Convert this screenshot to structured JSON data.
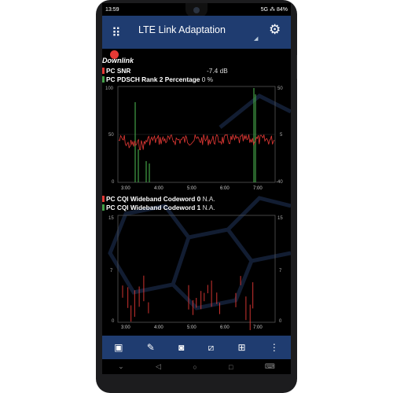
{
  "status": {
    "time": "13:59",
    "right": "5G ⁂ 84%"
  },
  "app": {
    "title": "LTE Link Adaptation"
  },
  "sections": {
    "downlink": "Downlink"
  },
  "metrics": {
    "pc_snr": {
      "label": "PC SNR",
      "value": "-7.4 dB",
      "color": "#e53935"
    },
    "pc_pdsch": {
      "label": "PC PDSCH Rank 2 Percentage",
      "value": "0 %",
      "color": "#43a047"
    },
    "cqi0": {
      "label": "PC CQI Wideband Codeword 0",
      "value": "N.A.",
      "color": "#e53935"
    },
    "cqi1": {
      "label": "PC CQI Wideband Codeword 1",
      "value": "N.A.",
      "color": "#43a047"
    }
  },
  "chart_data": [
    {
      "type": "line",
      "x_ticks": [
        "3:00",
        "4:00",
        "5:00",
        "6:00",
        "7:00"
      ],
      "y_left_ticks": [
        "100",
        "50",
        "0"
      ],
      "y_right_ticks": [
        "50",
        "5",
        "-40"
      ],
      "series": [
        {
          "values_note": "red SNR noisy around middle",
          "color": "#e53935"
        },
        {
          "color": "#43a047"
        }
      ]
    },
    {
      "type": "bar",
      "x_ticks": [
        "3:00",
        "4:00",
        "5:00",
        "6:00",
        "7:00"
      ],
      "y_left_ticks": [
        "15",
        "7",
        "0"
      ],
      "y_right_ticks": [
        "15",
        "7",
        "0"
      ]
    }
  ],
  "toolbar": {
    "icons": [
      "stop-icon",
      "pen-icon",
      "camera-icon",
      "code-icon",
      "grid-icon",
      "more-icon"
    ]
  }
}
